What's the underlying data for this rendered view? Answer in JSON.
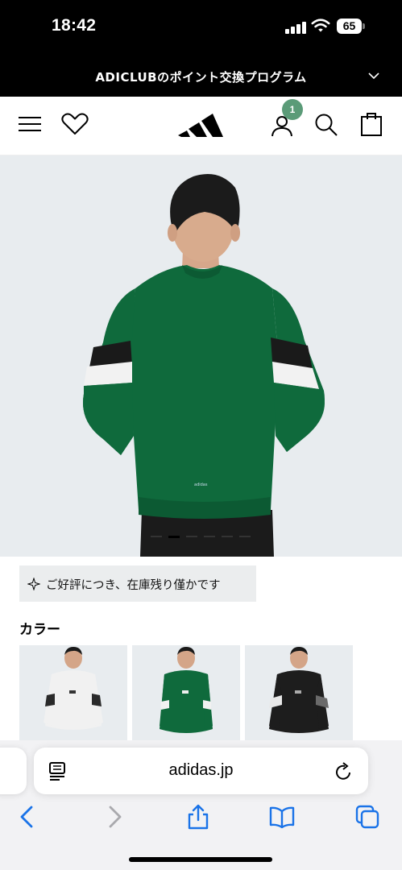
{
  "status_bar": {
    "time": "18:42",
    "battery_level": "65"
  },
  "promo_banner": {
    "text": "ADICLUBのポイント交換プログラム",
    "chevron": "chevron-down-icon"
  },
  "header": {
    "icons": [
      "menu-icon",
      "heart-icon",
      "adidas-logo",
      "account-icon",
      "search-icon",
      "bag-icon"
    ],
    "account_badge": "1",
    "badge_color": "#5b9b78"
  },
  "hero": {
    "background": "#e8ecef",
    "jacket_color": "#0f6a3c",
    "carousel_count": 6,
    "carousel_active_index": 1
  },
  "stock_badge": {
    "icon": "sparkle-icon",
    "text": "ご好評につき、在庫残り僅かです"
  },
  "color_section": {
    "title": "カラー",
    "swatches": [
      {
        "name": "white",
        "color": "#f1f1f1"
      },
      {
        "name": "green",
        "color": "#0f6a3c"
      },
      {
        "name": "black",
        "color": "#1d1d1d"
      }
    ]
  },
  "safari": {
    "url": "adidas.jp",
    "left_icon": "reader-icon",
    "right_icon": "reload-icon",
    "toolbar": [
      "back-icon",
      "forward-icon",
      "share-icon",
      "bookmarks-icon",
      "tabs-icon"
    ],
    "accent": "#1a73e8"
  }
}
